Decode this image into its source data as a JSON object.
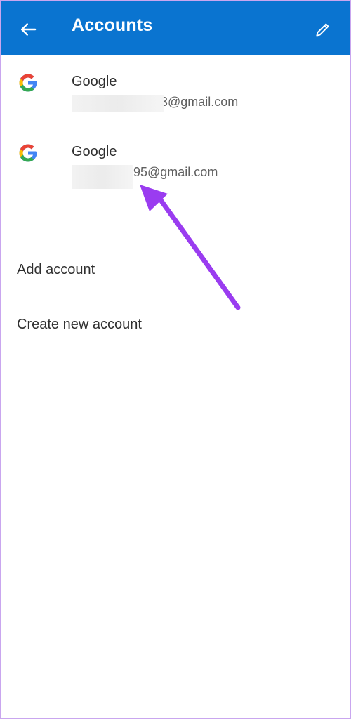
{
  "header": {
    "title": "Accounts",
    "back_icon": "arrow-left-icon",
    "edit_icon": "pencil-icon",
    "background": "#0a74d0"
  },
  "accounts": [
    {
      "provider": "Google",
      "email_visible": "3@gmail.com"
    },
    {
      "provider": "Google",
      "email_visible": "95@gmail.com"
    }
  ],
  "actions": {
    "add_account": "Add account",
    "create_new_account": "Create new account"
  },
  "annotation": {
    "arrow_color": "#9a3cf0"
  }
}
